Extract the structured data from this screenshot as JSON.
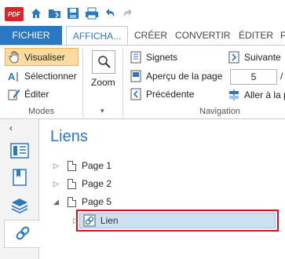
{
  "quick_access": {
    "logo_text": "PDF"
  },
  "tabs": [
    {
      "label": "FICHIER"
    },
    {
      "label": "AFFICHA..."
    },
    {
      "label": "CRÉER"
    },
    {
      "label": "CONVERTIR"
    },
    {
      "label": "ÉDITER"
    },
    {
      "label": "P"
    }
  ],
  "ribbon": {
    "modes": {
      "visualiser": "Visualiser",
      "selectionner": "Sélectionner",
      "editer": "Éditer",
      "group_label": "Modes"
    },
    "zoom": {
      "label": "Zoom"
    },
    "navigation": {
      "signets": "Signets",
      "apercu": "Aperçu de la page",
      "precedente": "Précédente",
      "suivante": "Suivante",
      "page_value": "5",
      "page_sep": "/",
      "aller": "Aller à la p",
      "group_label": "Navigation"
    }
  },
  "panel": {
    "title": "Liens",
    "tree": [
      {
        "label": "Page 1",
        "expanded": false
      },
      {
        "label": "Page 2",
        "expanded": false
      },
      {
        "label": "Page 5",
        "expanded": true
      },
      {
        "label": "Lien",
        "child": true,
        "selected": true
      }
    ]
  },
  "colors": {
    "accent": "#2b78c2",
    "highlight_border": "#d4121a",
    "selected_fill": "#cfe0f3",
    "pdf_logo": "#d4262b"
  }
}
